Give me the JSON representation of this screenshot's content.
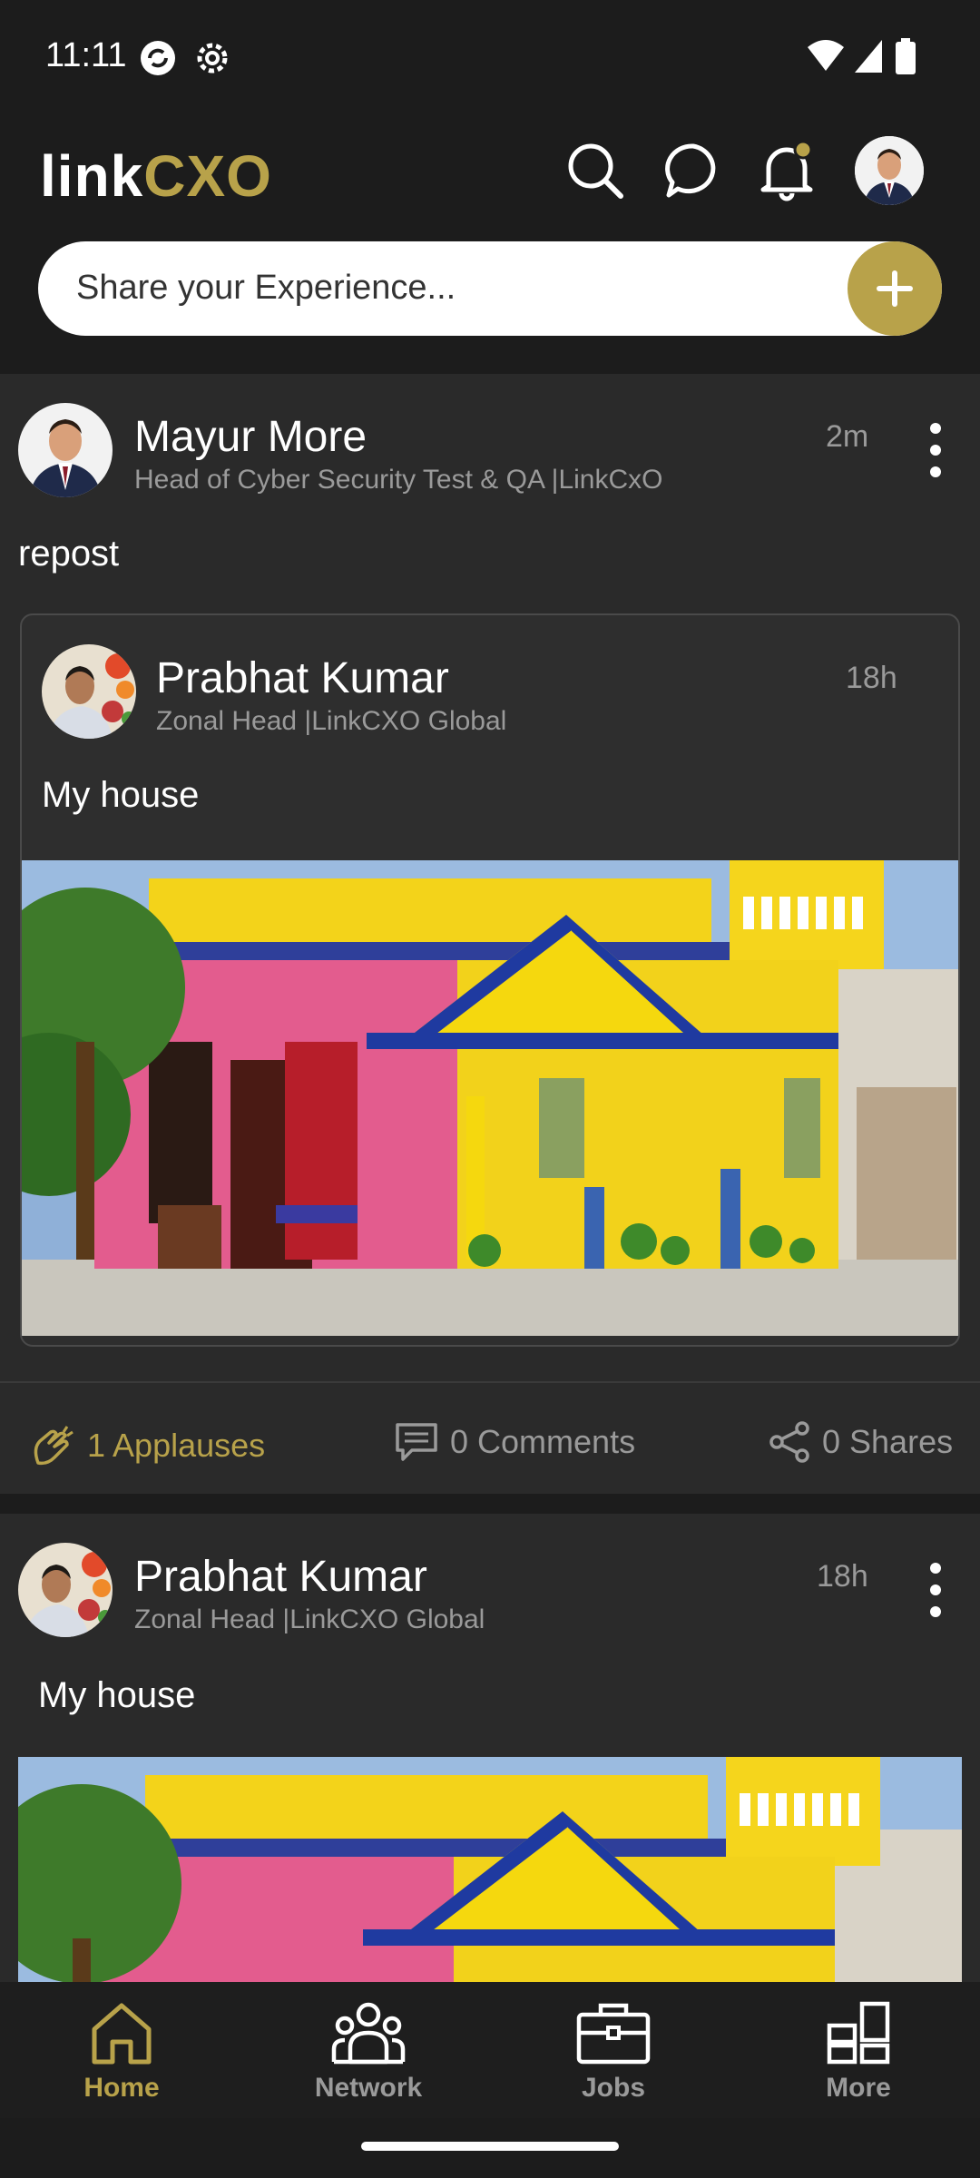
{
  "status": {
    "time": "11:11"
  },
  "header": {
    "logo_link": "link",
    "logo_cxo": "CXO",
    "share_placeholder": "Share your Experience..."
  },
  "posts": [
    {
      "author": "Mayur More",
      "role": "Head of Cyber Security Test & QA |LinkCxO",
      "time": "2m",
      "text": "repost",
      "repost": {
        "author": "Prabhat Kumar",
        "role": "Zonal Head |LinkCXO Global",
        "time": "18h",
        "text": "My house"
      },
      "actions": {
        "applause": "1 Applauses",
        "comments": "0 Comments",
        "shares": "0 Shares"
      }
    },
    {
      "author": "Prabhat Kumar",
      "role": "Zonal Head |LinkCXO Global",
      "time": "18h",
      "text": "My house"
    }
  ],
  "nav": {
    "items": [
      {
        "label": "Home",
        "icon": "home-icon",
        "active": true
      },
      {
        "label": "Network",
        "icon": "network-icon",
        "active": false
      },
      {
        "label": "Jobs",
        "icon": "briefcase-icon",
        "active": false
      },
      {
        "label": "More",
        "icon": "grid-icon",
        "active": false
      }
    ]
  },
  "colors": {
    "accent": "#b8a24a",
    "background": "#1c1c1c",
    "card": "#2a2a2a"
  }
}
